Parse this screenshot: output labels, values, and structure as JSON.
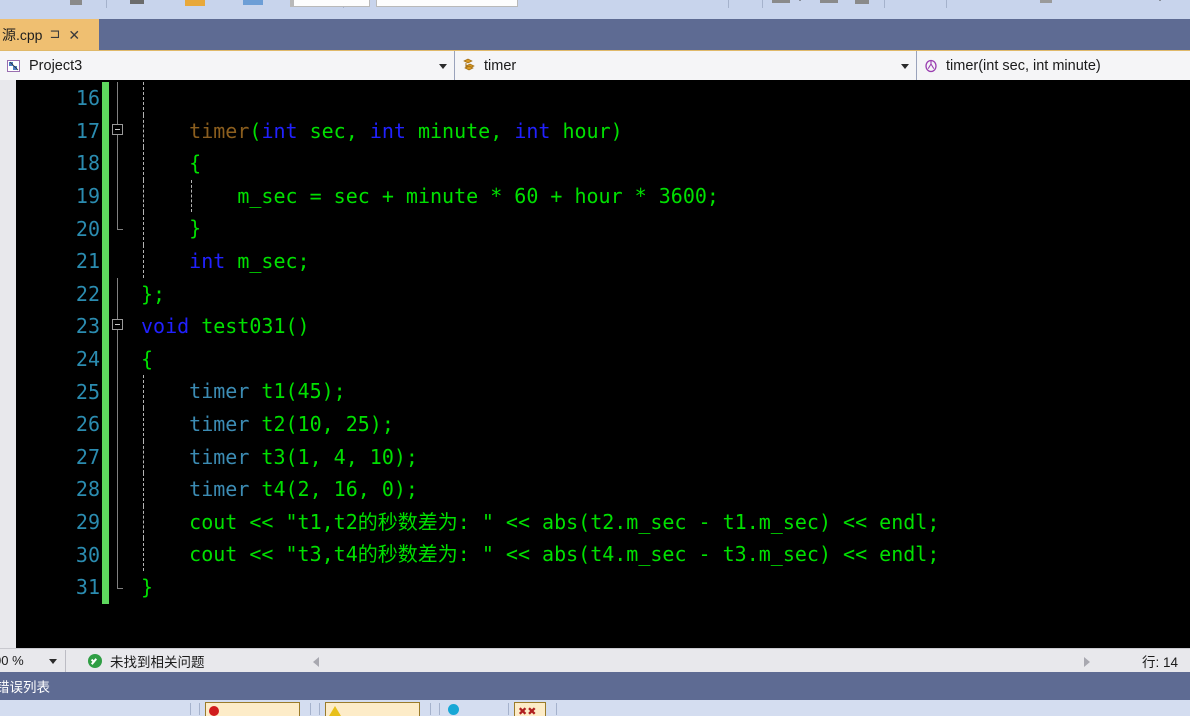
{
  "window": {
    "tab": {
      "label": "源.cpp",
      "pin_icon": "pin-icon",
      "close_icon": "close-icon"
    }
  },
  "navbar": {
    "project": {
      "icon": "project-icon",
      "label": "Project3"
    },
    "type": {
      "icon": "class-icon",
      "label": "timer"
    },
    "member": {
      "icon": "method-icon",
      "label": "timer(int sec, int minute)"
    }
  },
  "editor": {
    "first_line": 16,
    "lines": [
      {
        "num": "16",
        "changed": true,
        "fold": "line",
        "indents": [
          1
        ],
        "tokens": []
      },
      {
        "num": "17",
        "changed": true,
        "fold": "box",
        "indents": [
          1
        ],
        "tokens": [
          {
            "t": "    ",
            "c": "t-punct"
          },
          {
            "t": "timer",
            "c": "t-ctor"
          },
          {
            "t": "(",
            "c": "t-punct"
          },
          {
            "t": "int",
            "c": "t-kw"
          },
          {
            "t": " sec, ",
            "c": "t-id"
          },
          {
            "t": "int",
            "c": "t-kw"
          },
          {
            "t": " minute, ",
            "c": "t-id"
          },
          {
            "t": "int",
            "c": "t-kw"
          },
          {
            "t": " hour)",
            "c": "t-id"
          }
        ]
      },
      {
        "num": "18",
        "changed": true,
        "fold": "line",
        "indents": [
          1
        ],
        "tokens": [
          {
            "t": "    {",
            "c": "t-punct"
          }
        ]
      },
      {
        "num": "19",
        "changed": true,
        "fold": "line",
        "indents": [
          1,
          2
        ],
        "tokens": [
          {
            "t": "        m_sec = sec + minute * 60 + hour * 3600;",
            "c": "t-id"
          }
        ]
      },
      {
        "num": "20",
        "changed": true,
        "fold": "end",
        "indents": [
          1
        ],
        "tokens": [
          {
            "t": "    }",
            "c": "t-punct"
          }
        ]
      },
      {
        "num": "21",
        "changed": true,
        "fold": "none",
        "indents": [
          1
        ],
        "tokens": [
          {
            "t": "    ",
            "c": "t-punct"
          },
          {
            "t": "int",
            "c": "t-kw"
          },
          {
            "t": " m_sec;",
            "c": "t-id"
          }
        ]
      },
      {
        "num": "22",
        "changed": true,
        "fold": "close",
        "indents": [],
        "tokens": [
          {
            "t": "};",
            "c": "t-punct"
          }
        ]
      },
      {
        "num": "23",
        "changed": true,
        "fold": "box2",
        "indents": [],
        "tokens": [
          {
            "t": "void",
            "c": "t-kw"
          },
          {
            "t": " test031()",
            "c": "t-id"
          }
        ]
      },
      {
        "num": "24",
        "changed": true,
        "fold": "line",
        "indents": [],
        "tokens": [
          {
            "t": "{",
            "c": "t-punct"
          }
        ]
      },
      {
        "num": "25",
        "changed": true,
        "fold": "line",
        "indents": [
          1
        ],
        "tokens": [
          {
            "t": "    ",
            "c": "t-punct"
          },
          {
            "t": "timer",
            "c": "t-type"
          },
          {
            "t": " t1(45);",
            "c": "t-id"
          }
        ]
      },
      {
        "num": "26",
        "changed": true,
        "fold": "line",
        "indents": [
          1
        ],
        "tokens": [
          {
            "t": "    ",
            "c": "t-punct"
          },
          {
            "t": "timer",
            "c": "t-type"
          },
          {
            "t": " t2(10, 25);",
            "c": "t-id"
          }
        ]
      },
      {
        "num": "27",
        "changed": true,
        "fold": "line",
        "indents": [
          1
        ],
        "tokens": [
          {
            "t": "    ",
            "c": "t-punct"
          },
          {
            "t": "timer",
            "c": "t-type"
          },
          {
            "t": " t3(1, 4, 10);",
            "c": "t-id"
          }
        ]
      },
      {
        "num": "28",
        "changed": true,
        "fold": "line",
        "indents": [
          1
        ],
        "tokens": [
          {
            "t": "    ",
            "c": "t-punct"
          },
          {
            "t": "timer",
            "c": "t-type"
          },
          {
            "t": " t4(2, 16, 0);",
            "c": "t-id"
          }
        ]
      },
      {
        "num": "29",
        "changed": true,
        "fold": "line",
        "indents": [
          1
        ],
        "tokens": [
          {
            "t": "    cout << \"t1,t2的秒数差为: \" << abs(t2.m_sec - t1.m_sec) << endl;",
            "c": "t-id"
          }
        ]
      },
      {
        "num": "30",
        "changed": true,
        "fold": "line",
        "indents": [
          1
        ],
        "tokens": [
          {
            "t": "    cout << \"t3,t4的秒数差为: \" << abs(t4.m_sec - t3.m_sec) << endl;",
            "c": "t-id"
          }
        ]
      },
      {
        "num": "31",
        "changed": true,
        "fold": "endb",
        "indents": [],
        "tokens": [
          {
            "t": "}",
            "c": "t-punct"
          }
        ]
      }
    ]
  },
  "statusbar": {
    "zoom": "00 %",
    "issue_icon": "check-circle-icon",
    "issue_text": "未找到相关问题",
    "prev_icon": "prev-arrow-icon",
    "next_icon": "next-arrow-icon",
    "line_info": "行: 14"
  },
  "error_panel": {
    "title": "错误列表",
    "buttons": [
      {
        "icon": "error-icon",
        "name": "errors-filter-button"
      },
      {
        "icon": "warning-icon",
        "name": "warnings-filter-button"
      },
      {
        "icon": "info-icon",
        "name": "messages-filter-button"
      },
      {
        "icon": "build-icon",
        "name": "build-filter-button"
      }
    ]
  },
  "colors": {
    "tab_active": "#efbf71",
    "titlebar": "#5e6b93",
    "toolbar": "#c8d4ec",
    "editor_bg": "#000000",
    "linenum": "#2b8cb0",
    "keyword": "#2121ff",
    "identifier": "#00e000",
    "type": "#3c8cb4",
    "constructor": "#8b5e1e",
    "change_marker": "#5ed75e",
    "statusbar": "#e8e8ec"
  }
}
